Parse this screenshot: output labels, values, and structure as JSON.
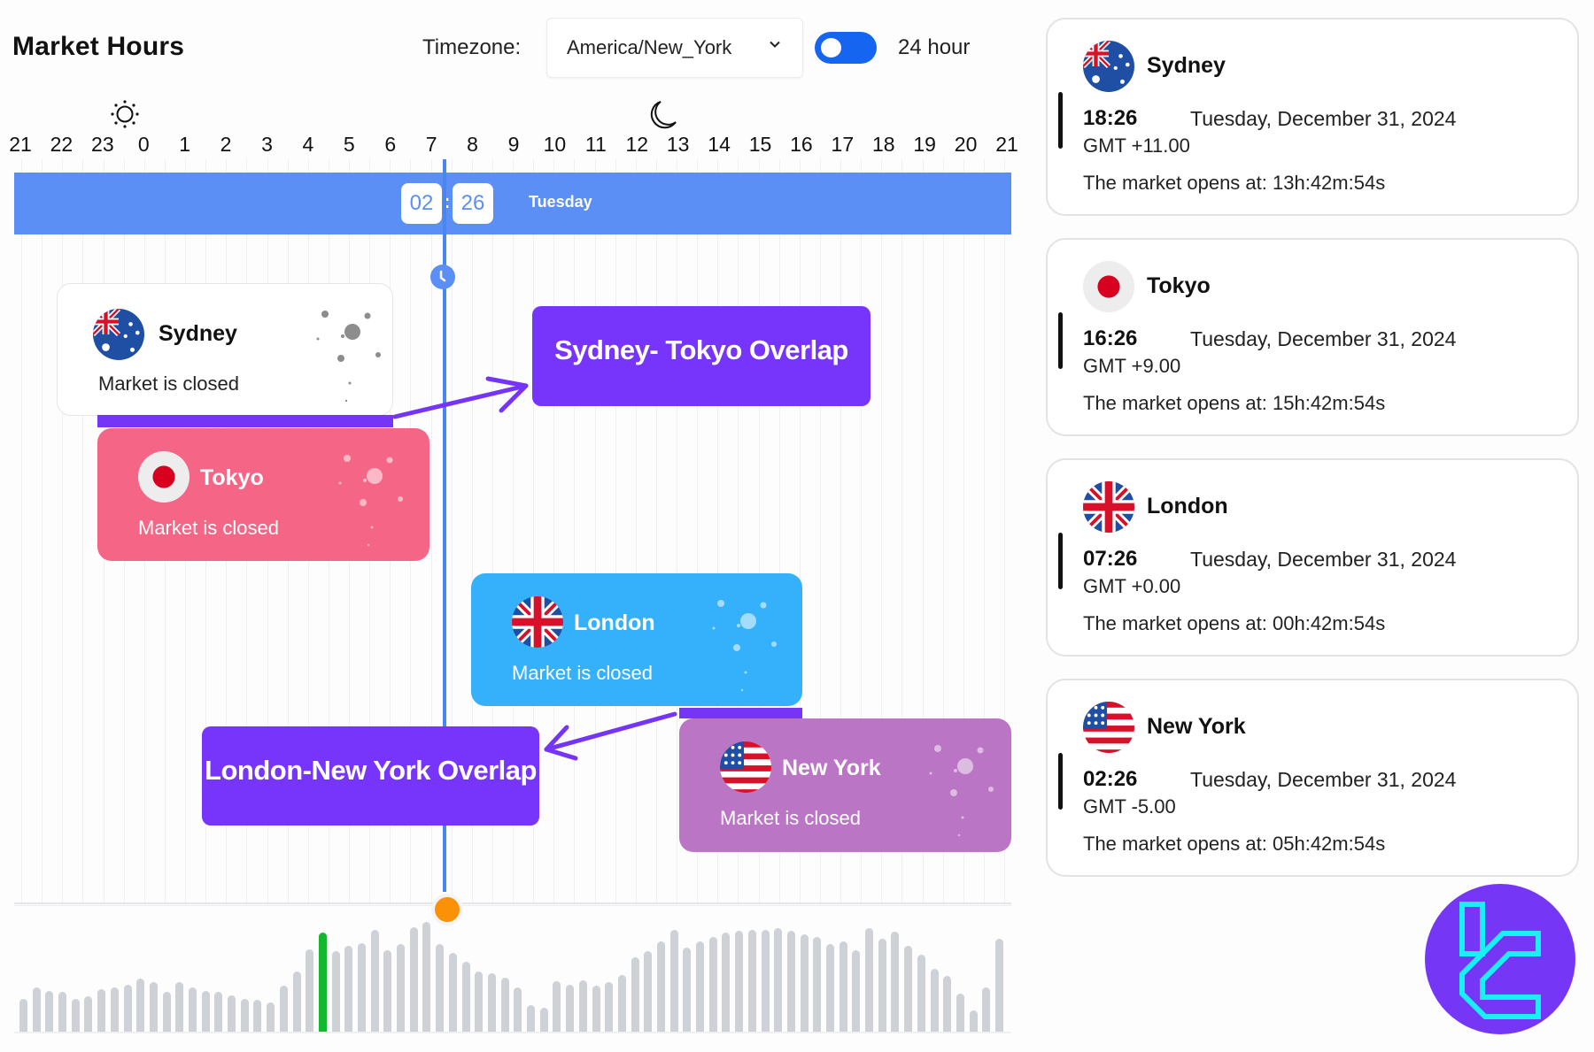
{
  "header": {
    "title": "Market Hours",
    "timezone_label": "Timezone:",
    "timezone_value": "America/New_York",
    "format_toggle_label": "24 hour",
    "format_toggle_on": true
  },
  "timeline": {
    "hour_labels": [
      "21",
      "22",
      "23",
      "0",
      "1",
      "2",
      "3",
      "4",
      "5",
      "6",
      "7",
      "8",
      "9",
      "10",
      "11",
      "12",
      "13",
      "14",
      "15",
      "16",
      "17",
      "18",
      "19",
      "20",
      "21"
    ],
    "day_icon": "sun-icon",
    "night_icon": "moon-icon",
    "current_hour": "02",
    "current_minute": "26",
    "time_separator": ":",
    "current_day": "Tuesday"
  },
  "sessions": [
    {
      "city": "Sydney",
      "status": "Market is closed",
      "flag": "australia-flag",
      "color": "#ffffff"
    },
    {
      "city": "Tokyo",
      "status": "Market is closed",
      "flag": "japan-flag",
      "color": "#f56586"
    },
    {
      "city": "London",
      "status": "Market is closed",
      "flag": "uk-flag",
      "color": "#35b1fb"
    },
    {
      "city": "New York",
      "status": "Market is closed",
      "flag": "us-flag",
      "color": "#ba76c4"
    }
  ],
  "overlaps": [
    {
      "label": "Sydney- Tokyo Overlap",
      "color": "#7734fa"
    },
    {
      "label": "London-New York Overlap",
      "color": "#7734fa"
    }
  ],
  "activity": {
    "values": [
      30,
      40,
      37,
      36,
      30,
      32,
      39,
      40,
      43,
      48,
      45,
      36,
      45,
      40,
      37,
      36,
      33,
      30,
      29,
      27,
      42,
      55,
      75,
      90,
      73,
      78,
      81,
      93,
      74,
      80,
      95,
      100,
      80,
      72,
      64,
      55,
      53,
      49,
      40,
      24,
      22,
      46,
      43,
      47,
      42,
      45,
      52,
      68,
      73,
      82,
      93,
      77,
      82,
      86,
      90,
      92,
      93,
      93,
      94,
      92,
      89,
      86,
      80,
      82,
      74,
      94,
      85,
      91,
      78,
      70,
      57,
      51,
      35,
      19,
      40,
      85
    ],
    "active_index": 23,
    "active_color": "#14b82f",
    "bar_color": "#ced1d5"
  },
  "market_cards": [
    {
      "city": "Sydney",
      "time": "18:26",
      "date": "Tuesday, December 31, 2024",
      "gmt": "GMT +11.00",
      "opens": "The market opens at: 13h:42m:54s"
    },
    {
      "city": "Tokyo",
      "time": "16:26",
      "date": "Tuesday, December 31, 2024",
      "gmt": "GMT +9.00",
      "opens": "The market opens at: 15h:42m:54s"
    },
    {
      "city": "London",
      "time": "07:26",
      "date": "Tuesday, December 31, 2024",
      "gmt": "GMT +0.00",
      "opens": "The market opens at: 00h:42m:54s"
    },
    {
      "city": "New York",
      "time": "02:26",
      "date": "Tuesday, December 31, 2024",
      "gmt": "GMT -5.00",
      "opens": "The market opens at: 05h:42m:54s"
    }
  ],
  "brand": {
    "logo": "tradingfinder-logo",
    "accent": "#7636f6",
    "logo_stroke": "#19f0f6"
  }
}
